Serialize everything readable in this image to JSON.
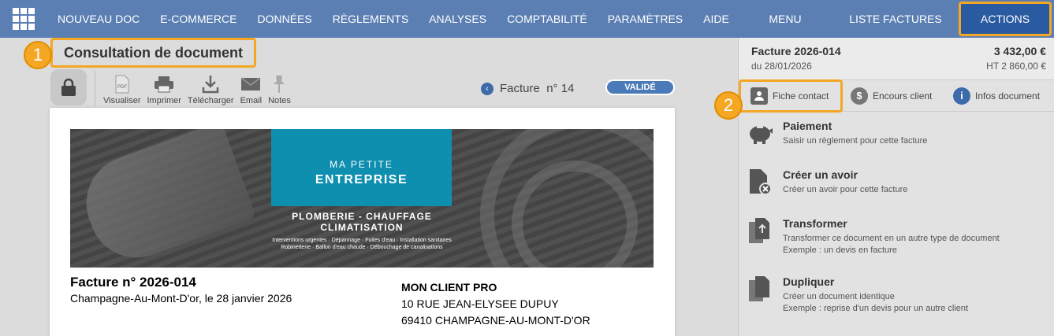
{
  "nav": {
    "items": [
      "NOUVEAU DOC",
      "E-COMMERCE",
      "DONNÉES",
      "RÈGLEMENTS",
      "ANALYSES",
      "COMPTABILITÉ",
      "PARAMÈTRES",
      "AIDE"
    ]
  },
  "right_header": {
    "menu": "MENU",
    "list": "LISTE FACTURES",
    "actions": "ACTIONS"
  },
  "page_title": "Consultation de document",
  "badges": {
    "one": "1",
    "two": "2"
  },
  "toolbar": {
    "visualiser": "Visualiser",
    "imprimer": "Imprimer",
    "telecharger": "Télécharger",
    "email": "Email",
    "notes": "Notes"
  },
  "doc_nav": {
    "label": "Facture",
    "number": "n° 14"
  },
  "status": "VALIDÉ",
  "banner": {
    "line1": "MA PETITE",
    "line2": "ENTREPRISE",
    "sub1": "PLOMBERIE - CHAUFFAGE",
    "sub2": "CLIMATISATION",
    "sub3": "Interventions urgentes · Dépannage · Fuites d'eau · Installation sanitaires",
    "sub4": "Robinetterie · Ballon d'eau chaude · Débouchage de canalisations"
  },
  "document": {
    "title": "Facture n° 2026-014",
    "place_date": "Champagne-Au-Mont-D'or, le 28 janvier 2026",
    "client_name": "MON CLIENT PRO",
    "client_addr1": "10 RUE JEAN-ELYSEE DUPUY",
    "client_addr2": "69410 CHAMPAGNE-AU-MONT-D'OR"
  },
  "summary": {
    "number": "Facture 2026-014",
    "date": "du 28/01/2026",
    "ttc": "3 432,00 €",
    "ht": "HT 2 860,00 €"
  },
  "tabs": {
    "contact": "Fiche contact",
    "encours": "Encours client",
    "infos": "Infos document"
  },
  "actions": [
    {
      "title": "Paiement",
      "desc1": "Saisir un règlement pour cette facture",
      "desc2": ""
    },
    {
      "title": "Créer un avoir",
      "desc1": "Créer un avoir pour cette facture",
      "desc2": ""
    },
    {
      "title": "Transformer",
      "desc1": "Transformer ce document en un autre type de document",
      "desc2": "Exemple : un devis en facture"
    },
    {
      "title": "Dupliquer",
      "desc1": "Créer un document identique",
      "desc2": "Exemple : reprise d'un devis pour un autre client"
    }
  ]
}
